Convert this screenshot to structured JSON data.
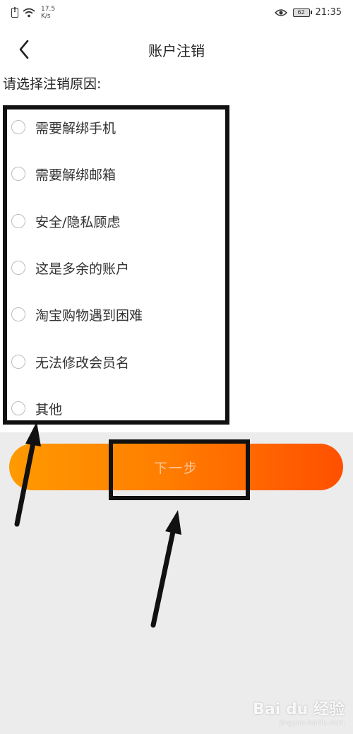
{
  "status_bar": {
    "net_speed": "17.5",
    "net_unit": "K/s",
    "battery": "62",
    "time": "21:35"
  },
  "header": {
    "title": "账户注销"
  },
  "form": {
    "prompt": "请选择注销原因:",
    "reasons": [
      "需要解绑手机",
      "需要解绑邮箱",
      "安全/隐私顾虑",
      "这是多余的账户",
      "淘宝购物遇到困难",
      "无法修改会员名",
      "其他"
    ]
  },
  "actions": {
    "next_label": "下一步"
  },
  "watermark": {
    "logo": "Bai du 经验",
    "url": "jingyan.baidu.com"
  },
  "colors": {
    "button_gradient_start": "#ff9a00",
    "button_gradient_end": "#ff5000",
    "button_text": "#ffc79a",
    "page_background": "#ececec",
    "annotation": "#111111"
  }
}
